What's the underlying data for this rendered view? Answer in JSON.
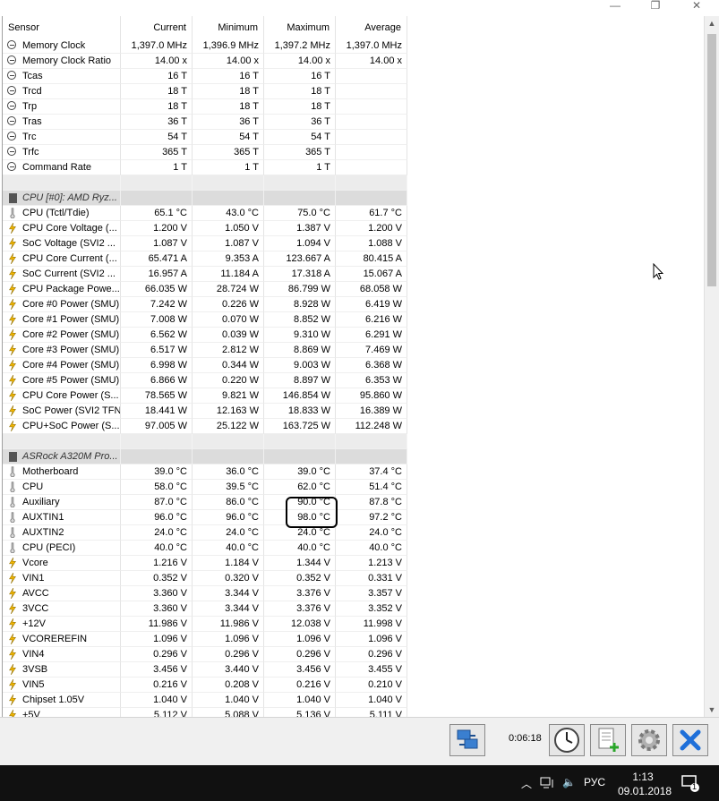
{
  "window": {
    "minimize_glyph": "—",
    "maximize_glyph": "❐",
    "close_glyph": "✕"
  },
  "columns": {
    "sensor": "Sensor",
    "current": "Current",
    "minimum": "Minimum",
    "maximum": "Maximum",
    "average": "Average"
  },
  "rows": [
    {
      "type": "data",
      "icon": "clock-icon",
      "name": "Memory Clock",
      "current": "1,397.0 MHz",
      "minimum": "1,396.9 MHz",
      "maximum": "1,397.2 MHz",
      "average": "1,397.0 MHz"
    },
    {
      "type": "data",
      "icon": "clock-icon",
      "name": "Memory Clock Ratio",
      "current": "14.00 x",
      "minimum": "14.00 x",
      "maximum": "14.00 x",
      "average": "14.00 x"
    },
    {
      "type": "data",
      "icon": "clock-icon",
      "name": "Tcas",
      "current": "16 T",
      "minimum": "16 T",
      "maximum": "16 T",
      "average": ""
    },
    {
      "type": "data",
      "icon": "clock-icon",
      "name": "Trcd",
      "current": "18 T",
      "minimum": "18 T",
      "maximum": "18 T",
      "average": ""
    },
    {
      "type": "data",
      "icon": "clock-icon",
      "name": "Trp",
      "current": "18 T",
      "minimum": "18 T",
      "maximum": "18 T",
      "average": ""
    },
    {
      "type": "data",
      "icon": "clock-icon",
      "name": "Tras",
      "current": "36 T",
      "minimum": "36 T",
      "maximum": "36 T",
      "average": ""
    },
    {
      "type": "data",
      "icon": "clock-icon",
      "name": "Trc",
      "current": "54 T",
      "minimum": "54 T",
      "maximum": "54 T",
      "average": ""
    },
    {
      "type": "data",
      "icon": "clock-icon",
      "name": "Trfc",
      "current": "365 T",
      "minimum": "365 T",
      "maximum": "365 T",
      "average": ""
    },
    {
      "type": "data",
      "icon": "clock-icon",
      "name": "Command Rate",
      "current": "1 T",
      "minimum": "1 T",
      "maximum": "1 T",
      "average": ""
    },
    {
      "type": "blank",
      "name": "",
      "current": "",
      "minimum": "",
      "maximum": "",
      "average": ""
    },
    {
      "type": "group",
      "icon": "chip-icon",
      "name": "CPU [#0]: AMD Ryz...",
      "current": "",
      "minimum": "",
      "maximum": "",
      "average": ""
    },
    {
      "type": "data",
      "icon": "thermometer-icon",
      "name": "CPU (Tctl/Tdie)",
      "current": "65.1 °C",
      "minimum": "43.0 °C",
      "maximum": "75.0 °C",
      "average": "61.7 °C"
    },
    {
      "type": "data",
      "icon": "lightning-icon",
      "name": "CPU Core Voltage (...",
      "current": "1.200 V",
      "minimum": "1.050 V",
      "maximum": "1.387 V",
      "average": "1.200 V"
    },
    {
      "type": "data",
      "icon": "lightning-icon",
      "name": "SoC Voltage (SVI2 ...",
      "current": "1.087 V",
      "minimum": "1.087 V",
      "maximum": "1.094 V",
      "average": "1.088 V"
    },
    {
      "type": "data",
      "icon": "lightning-icon",
      "name": "CPU Core Current (...",
      "current": "65.471 A",
      "minimum": "9.353 A",
      "maximum": "123.667 A",
      "average": "80.415 A"
    },
    {
      "type": "data",
      "icon": "lightning-icon",
      "name": "SoC Current (SVI2 ...",
      "current": "16.957 A",
      "minimum": "11.184 A",
      "maximum": "17.318 A",
      "average": "15.067 A"
    },
    {
      "type": "data",
      "icon": "lightning-icon",
      "name": "CPU Package Powe...",
      "current": "66.035 W",
      "minimum": "28.724 W",
      "maximum": "86.799 W",
      "average": "68.058 W"
    },
    {
      "type": "data",
      "icon": "lightning-icon",
      "name": "Core #0 Power (SMU)",
      "current": "7.242 W",
      "minimum": "0.226 W",
      "maximum": "8.928 W",
      "average": "6.419 W"
    },
    {
      "type": "data",
      "icon": "lightning-icon",
      "name": "Core #1 Power (SMU)",
      "current": "7.008 W",
      "minimum": "0.070 W",
      "maximum": "8.852 W",
      "average": "6.216 W"
    },
    {
      "type": "data",
      "icon": "lightning-icon",
      "name": "Core #2 Power (SMU)",
      "current": "6.562 W",
      "minimum": "0.039 W",
      "maximum": "9.310 W",
      "average": "6.291 W"
    },
    {
      "type": "data",
      "icon": "lightning-icon",
      "name": "Core #3 Power (SMU)",
      "current": "6.517 W",
      "minimum": "2.812 W",
      "maximum": "8.869 W",
      "average": "7.469 W"
    },
    {
      "type": "data",
      "icon": "lightning-icon",
      "name": "Core #4 Power (SMU)",
      "current": "6.998 W",
      "minimum": "0.344 W",
      "maximum": "9.003 W",
      "average": "6.368 W"
    },
    {
      "type": "data",
      "icon": "lightning-icon",
      "name": "Core #5 Power (SMU)",
      "current": "6.866 W",
      "minimum": "0.220 W",
      "maximum": "8.897 W",
      "average": "6.353 W"
    },
    {
      "type": "data",
      "icon": "lightning-icon",
      "name": "CPU Core Power (S...",
      "current": "78.565 W",
      "minimum": "9.821 W",
      "maximum": "146.854 W",
      "average": "95.860 W"
    },
    {
      "type": "data",
      "icon": "lightning-icon",
      "name": "SoC Power (SVI2 TFN)",
      "current": "18.441 W",
      "minimum": "12.163 W",
      "maximum": "18.833 W",
      "average": "16.389 W"
    },
    {
      "type": "data",
      "icon": "lightning-icon",
      "name": "CPU+SoC Power (S...",
      "current": "97.005 W",
      "minimum": "25.122 W",
      "maximum": "163.725 W",
      "average": "112.248 W"
    },
    {
      "type": "blank",
      "name": "",
      "current": "",
      "minimum": "",
      "maximum": "",
      "average": ""
    },
    {
      "type": "group",
      "icon": "chip-icon",
      "name": "ASRock A320M Pro...",
      "current": "",
      "minimum": "",
      "maximum": "",
      "average": ""
    },
    {
      "type": "data",
      "icon": "thermometer-icon",
      "name": "Motherboard",
      "current": "39.0 °C",
      "minimum": "36.0 °C",
      "maximum": "39.0 °C",
      "average": "37.4 °C"
    },
    {
      "type": "data",
      "icon": "thermometer-icon",
      "name": "CPU",
      "current": "58.0 °C",
      "minimum": "39.5 °C",
      "maximum": "62.0 °C",
      "average": "51.4 °C"
    },
    {
      "type": "data",
      "icon": "thermometer-icon",
      "name": "Auxiliary",
      "current": "87.0 °C",
      "minimum": "86.0 °C",
      "maximum": "90.0 °C",
      "average": "87.8 °C"
    },
    {
      "type": "data",
      "icon": "thermometer-icon",
      "name": "AUXTIN1",
      "current": "96.0 °C",
      "minimum": "96.0 °C",
      "maximum": "98.0 °C",
      "average": "97.2 °C"
    },
    {
      "type": "data",
      "icon": "thermometer-icon",
      "name": "AUXTIN2",
      "current": "24.0 °C",
      "minimum": "24.0 °C",
      "maximum": "24.0 °C",
      "average": "24.0 °C"
    },
    {
      "type": "data",
      "icon": "thermometer-icon",
      "name": "CPU (PECI)",
      "current": "40.0 °C",
      "minimum": "40.0 °C",
      "maximum": "40.0 °C",
      "average": "40.0 °C"
    },
    {
      "type": "data",
      "icon": "lightning-icon",
      "name": "Vcore",
      "current": "1.216 V",
      "minimum": "1.184 V",
      "maximum": "1.344 V",
      "average": "1.213 V"
    },
    {
      "type": "data",
      "icon": "lightning-icon",
      "name": "VIN1",
      "current": "0.352 V",
      "minimum": "0.320 V",
      "maximum": "0.352 V",
      "average": "0.331 V"
    },
    {
      "type": "data",
      "icon": "lightning-icon",
      "name": "AVCC",
      "current": "3.360 V",
      "minimum": "3.344 V",
      "maximum": "3.376 V",
      "average": "3.357 V"
    },
    {
      "type": "data",
      "icon": "lightning-icon",
      "name": "3VCC",
      "current": "3.360 V",
      "minimum": "3.344 V",
      "maximum": "3.376 V",
      "average": "3.352 V"
    },
    {
      "type": "data",
      "icon": "lightning-icon",
      "name": "+12V",
      "current": "11.986 V",
      "minimum": "11.986 V",
      "maximum": "12.038 V",
      "average": "11.998 V"
    },
    {
      "type": "data",
      "icon": "lightning-icon",
      "name": "VCOREREFIN",
      "current": "1.096 V",
      "minimum": "1.096 V",
      "maximum": "1.096 V",
      "average": "1.096 V"
    },
    {
      "type": "data",
      "icon": "lightning-icon",
      "name": "VIN4",
      "current": "0.296 V",
      "minimum": "0.296 V",
      "maximum": "0.296 V",
      "average": "0.296 V"
    },
    {
      "type": "data",
      "icon": "lightning-icon",
      "name": "3VSB",
      "current": "3.456 V",
      "minimum": "3.440 V",
      "maximum": "3.456 V",
      "average": "3.455 V"
    },
    {
      "type": "data",
      "icon": "lightning-icon",
      "name": "VIN5",
      "current": "0.216 V",
      "minimum": "0.208 V",
      "maximum": "0.216 V",
      "average": "0.210 V"
    },
    {
      "type": "data",
      "icon": "lightning-icon",
      "name": "Chipset 1.05V",
      "current": "1.040 V",
      "minimum": "1.040 V",
      "maximum": "1.040 V",
      "average": "1.040 V"
    },
    {
      "type": "data",
      "icon": "lightning-icon",
      "name": "+5V",
      "current": "5.112 V",
      "minimum": "5.088 V",
      "maximum": "5.136 V",
      "average": "5.111 V"
    }
  ],
  "toolbar": {
    "elapsed_time": "0:06:18"
  },
  "taskbar": {
    "language": "РУС",
    "time": "1:13",
    "date": "09.01.2018",
    "notification_count": "1"
  },
  "colors": {
    "lightning": "#f2b600",
    "thermometer": "#7a7a7a",
    "close_x": "#1e6fd9",
    "annotation": "#000000"
  }
}
